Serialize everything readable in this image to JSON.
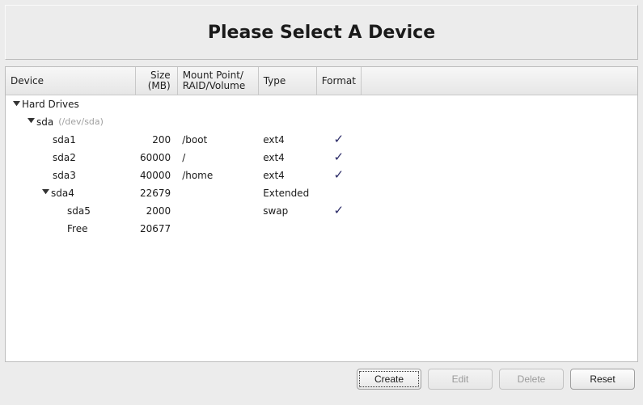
{
  "title": "Please Select A Device",
  "columns": {
    "device": "Device",
    "size": "Size\n(MB)",
    "mount": "Mount Point/\nRAID/Volume",
    "type": "Type",
    "format": "Format"
  },
  "tree": [
    {
      "kind": "group",
      "indent": 0,
      "expanded": true,
      "label": "Hard Drives"
    },
    {
      "kind": "disk",
      "indent": 1,
      "expanded": true,
      "label": "sda",
      "devpath": "(/dev/sda)"
    },
    {
      "kind": "part",
      "indent": 2,
      "label": "sda1",
      "size": "200",
      "mount": "/boot",
      "type": "ext4",
      "format": true
    },
    {
      "kind": "part",
      "indent": 2,
      "label": "sda2",
      "size": "60000",
      "mount": "/",
      "type": "ext4",
      "format": true
    },
    {
      "kind": "part",
      "indent": 2,
      "label": "sda3",
      "size": "40000",
      "mount": "/home",
      "type": "ext4",
      "format": true
    },
    {
      "kind": "part",
      "indent": 2,
      "expanded": true,
      "label": "sda4",
      "size": "22679",
      "mount": "",
      "type": "Extended",
      "format": false
    },
    {
      "kind": "part",
      "indent": 3,
      "label": "sda5",
      "size": "2000",
      "mount": "",
      "type": "swap",
      "format": true
    },
    {
      "kind": "free",
      "indent": 3,
      "label": "Free",
      "size": "20677",
      "mount": "",
      "type": "",
      "format": false
    }
  ],
  "buttons": {
    "create": "Create",
    "edit": "Edit",
    "delete": "Delete",
    "reset": "Reset"
  }
}
